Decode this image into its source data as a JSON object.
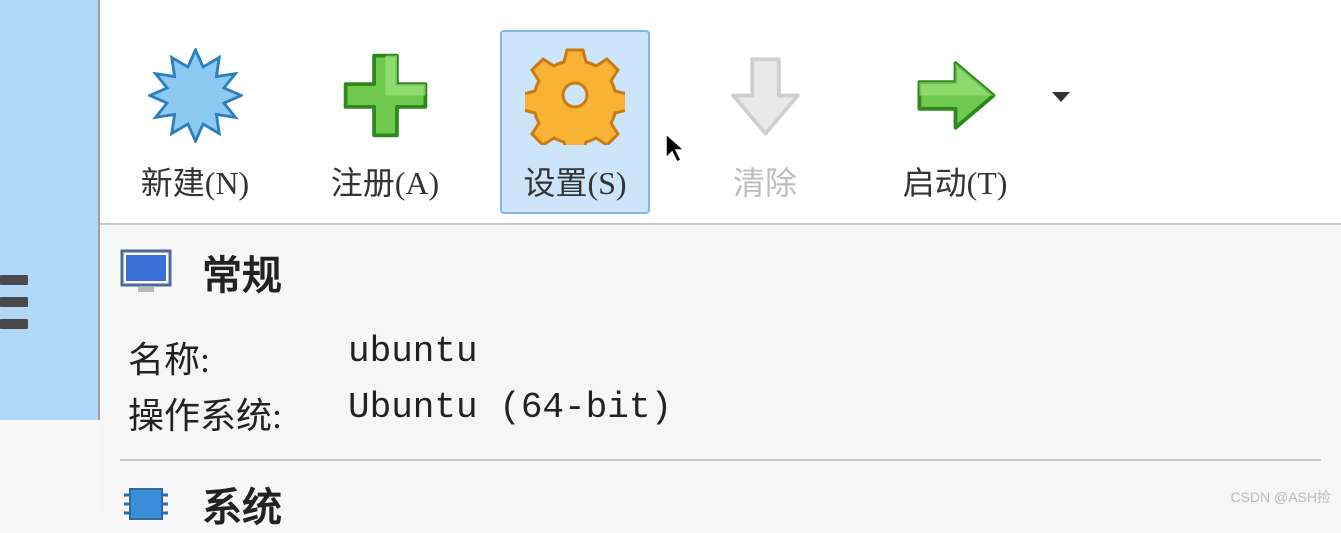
{
  "toolbar": {
    "new_label": "新建(N)",
    "add_label": "注册(A)",
    "settings_label": "设置(S)",
    "discard_label": "清除",
    "start_label": "启动(T)"
  },
  "details": {
    "general": {
      "title": "常规",
      "name_label": "名称:",
      "name_value": "ubuntu",
      "os_label": "操作系统:",
      "os_value": "Ubuntu (64-bit)"
    },
    "system": {
      "title": "系统"
    }
  },
  "watermark": "CSDN @ASH捡"
}
